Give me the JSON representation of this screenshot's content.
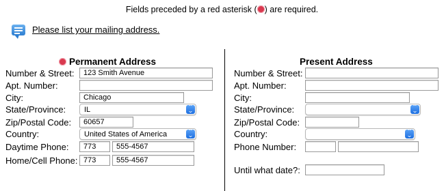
{
  "notice": {
    "before": "Fields preceded by a red asterisk (",
    "after": ") are required."
  },
  "help": {
    "link": "Please list your mailing address."
  },
  "permanent": {
    "title": "Permanent Address",
    "labels": {
      "street": "Number & Street:",
      "apt": "Apt. Number:",
      "city": "City:",
      "state": "State/Province:",
      "zip": "Zip/Postal Code:",
      "country": "Country:",
      "day_phone": "Daytime Phone:",
      "cell_phone": "Home/Cell Phone:"
    },
    "values": {
      "street": "123 Smith Avenue",
      "apt": "",
      "city": "Chicago",
      "state": "IL",
      "zip": "60657",
      "country": "United States of America",
      "day_area": "773",
      "day_number": "555-4567",
      "cell_area": "773",
      "cell_number": "555-4567"
    }
  },
  "present": {
    "title": "Present Address",
    "labels": {
      "street": "Number & Street:",
      "apt": "Apt. Number:",
      "city": "City:",
      "state": "State/Province:",
      "zip": "Zip/Postal Code:",
      "country": "Country:",
      "phone": "Phone Number:",
      "until": "Until what date?:"
    },
    "values": {
      "street": "",
      "apt": "",
      "city": "",
      "state": "",
      "zip": "",
      "country": "",
      "phone_area": "",
      "phone_number": "",
      "until": ""
    }
  },
  "icons": {
    "required": "red-asterisk-icon",
    "help": "speech-bubble-icon",
    "select": "chevron-up-down-icon"
  },
  "colors": {
    "asterisk": "#d9394f",
    "select_button": "#2f7fe6"
  }
}
